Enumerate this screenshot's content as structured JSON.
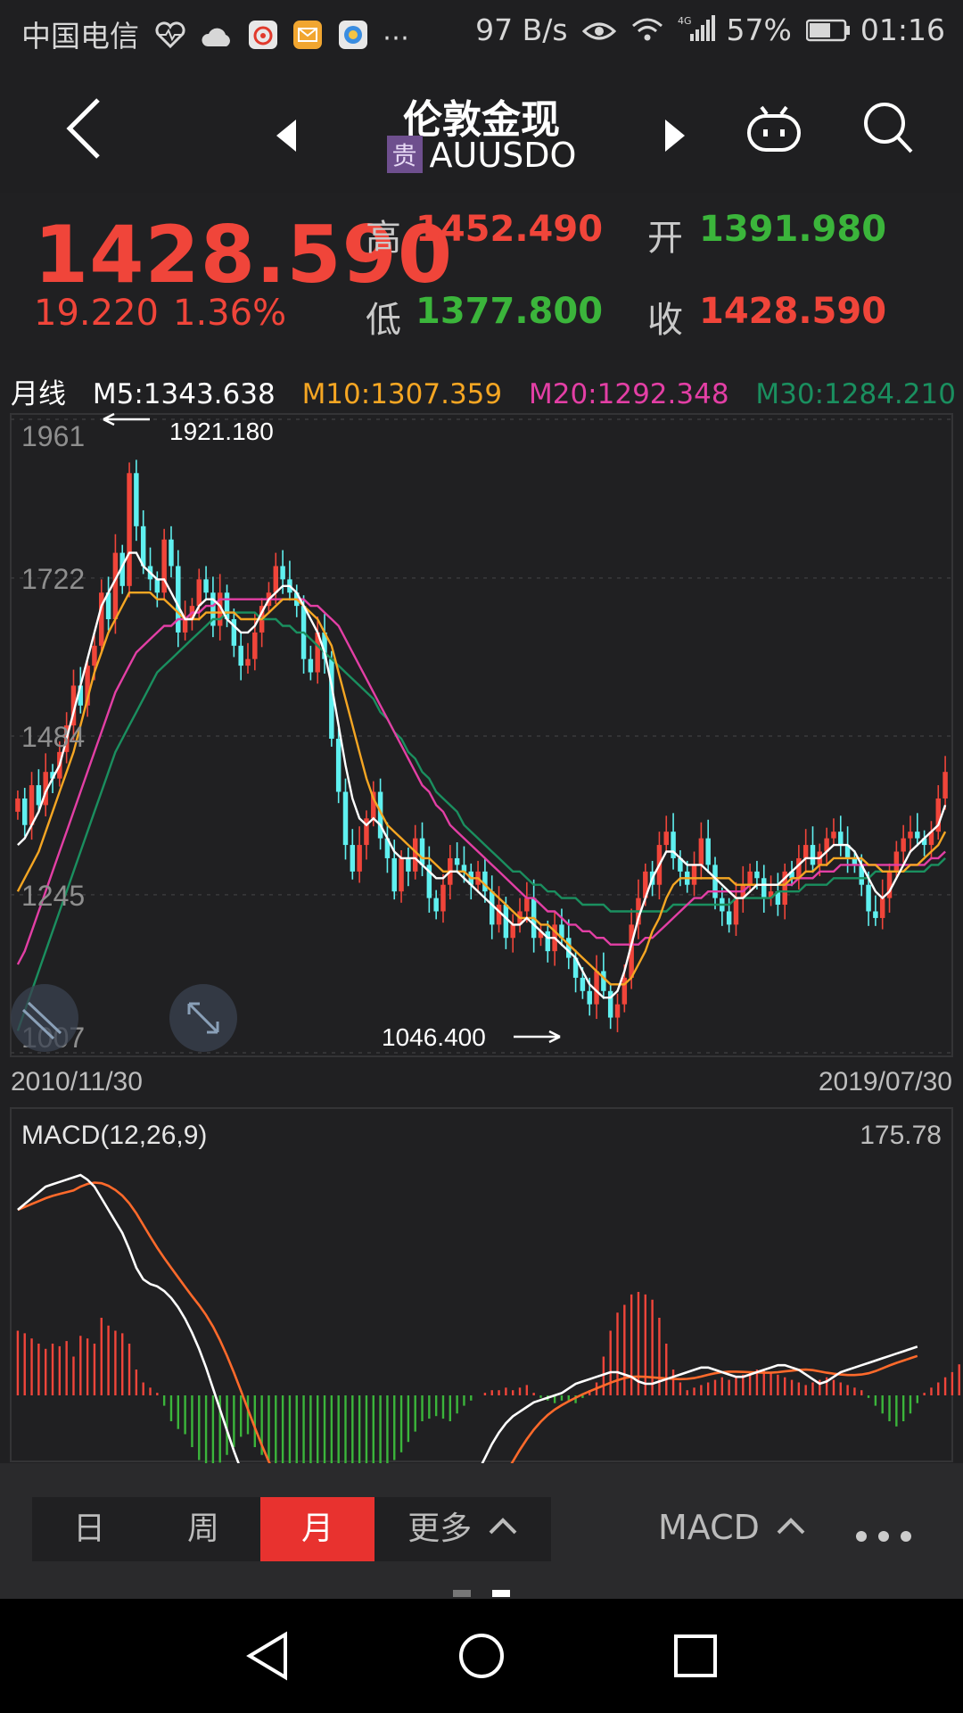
{
  "status_bar": {
    "carrier": "中国电信",
    "speed": "97 B/s",
    "battery": "57%",
    "time": "01:16"
  },
  "header": {
    "title": "伦敦金现",
    "category_tag": "贵",
    "symbol": "AUUSDO",
    "icons": [
      "back-arrow-icon",
      "prev-triangle-icon",
      "next-triangle-icon",
      "robot-icon",
      "search-icon"
    ]
  },
  "quote": {
    "price": "1428.590",
    "change": "19.220",
    "change_pct": "1.36%",
    "high_label": "高",
    "high": "1452.490",
    "low_label": "低",
    "low": "1377.800",
    "open_label": "开",
    "open": "1391.980",
    "close_label": "收",
    "close": "1428.590"
  },
  "ma_legend": {
    "period": "月线",
    "m5": "M5:1343.638",
    "m10": "M10:1307.359",
    "m20": "M20:1292.348",
    "m30": "M30:1284.210",
    "colors": {
      "m5": "#ffffff",
      "m10": "#f5a623",
      "m20": "#e33fa5",
      "m30": "#1a8f5f"
    }
  },
  "chart_data": [
    {
      "type": "candlestick",
      "title": "",
      "y_ticks": [
        "1961",
        "1722",
        "1484",
        "1245",
        "1007"
      ],
      "ylim": [
        1007,
        1961
      ],
      "x_start": "2010/11/30",
      "x_end": "2019/07/30",
      "max_annotation": "1921.180",
      "min_annotation": "1046.400",
      "close": [
        1390,
        1350,
        1410,
        1380,
        1430,
        1420,
        1460,
        1500,
        1560,
        1530,
        1590,
        1620,
        1700,
        1660,
        1760,
        1710,
        1880,
        1800,
        1740,
        1720,
        1700,
        1780,
        1740,
        1640,
        1660,
        1680,
        1720,
        1700,
        1650,
        1700,
        1660,
        1620,
        1590,
        1600,
        1640,
        1680,
        1700,
        1740,
        1720,
        1700,
        1680,
        1600,
        1580,
        1640,
        1600,
        1480,
        1400,
        1320,
        1280,
        1320,
        1360,
        1400,
        1330,
        1300,
        1250,
        1300,
        1280,
        1330,
        1290,
        1240,
        1220,
        1260,
        1300,
        1290,
        1280,
        1260,
        1280,
        1250,
        1200,
        1230,
        1180,
        1200,
        1220,
        1240,
        1180,
        1190,
        1160,
        1200,
        1180,
        1150,
        1120,
        1100,
        1080,
        1130,
        1100,
        1060,
        1080,
        1120,
        1200,
        1240,
        1280,
        1260,
        1320,
        1340,
        1300,
        1280,
        1260,
        1290,
        1330,
        1290,
        1240,
        1220,
        1200,
        1240,
        1260,
        1280,
        1270,
        1240,
        1250,
        1230,
        1280,
        1270,
        1300,
        1320,
        1290,
        1310,
        1330,
        1340,
        1320,
        1300,
        1290,
        1260,
        1220,
        1210,
        1240,
        1280,
        1310,
        1330,
        1340,
        1330,
        1320,
        1340,
        1390,
        1430
      ],
      "m5": [
        1320,
        1330,
        1350,
        1370,
        1400,
        1420,
        1440,
        1480,
        1520,
        1560,
        1600,
        1640,
        1680,
        1700,
        1720,
        1740,
        1760,
        1760,
        1740,
        1730,
        1720,
        1720,
        1700,
        1680,
        1660,
        1660,
        1680,
        1690,
        1690,
        1680,
        1660,
        1650,
        1640,
        1640,
        1650,
        1670,
        1690,
        1700,
        1710,
        1710,
        1700,
        1680,
        1660,
        1640,
        1610,
        1560,
        1500,
        1440,
        1390,
        1360,
        1350,
        1360,
        1350,
        1330,
        1310,
        1300,
        1300,
        1300,
        1290,
        1280,
        1270,
        1270,
        1280,
        1280,
        1270,
        1260,
        1250,
        1240,
        1230,
        1220,
        1210,
        1200,
        1200,
        1210,
        1200,
        1190,
        1180,
        1180,
        1170,
        1160,
        1150,
        1130,
        1110,
        1100,
        1090,
        1090,
        1100,
        1130,
        1170,
        1210,
        1240,
        1270,
        1290,
        1310,
        1310,
        1300,
        1290,
        1290,
        1290,
        1280,
        1270,
        1260,
        1250,
        1240,
        1240,
        1250,
        1260,
        1260,
        1260,
        1260,
        1270,
        1280,
        1290,
        1300,
        1300,
        1300,
        1310,
        1320,
        1320,
        1320,
        1310,
        1290,
        1270,
        1250,
        1240,
        1250,
        1270,
        1290,
        1310,
        1320,
        1330,
        1340,
        1350,
        1380
      ],
      "m10": [
        1250,
        1270,
        1290,
        1310,
        1340,
        1370,
        1400,
        1430,
        1460,
        1500,
        1540,
        1580,
        1610,
        1640,
        1660,
        1680,
        1700,
        1700,
        1700,
        1700,
        1690,
        1690,
        1680,
        1670,
        1660,
        1660,
        1660,
        1670,
        1670,
        1670,
        1670,
        1670,
        1660,
        1660,
        1660,
        1660,
        1670,
        1680,
        1690,
        1690,
        1690,
        1680,
        1670,
        1660,
        1640,
        1620,
        1580,
        1540,
        1500,
        1460,
        1420,
        1390,
        1370,
        1350,
        1340,
        1330,
        1320,
        1310,
        1300,
        1300,
        1290,
        1280,
        1280,
        1280,
        1280,
        1270,
        1270,
        1260,
        1250,
        1240,
        1230,
        1220,
        1210,
        1210,
        1210,
        1200,
        1200,
        1190,
        1180,
        1170,
        1160,
        1150,
        1140,
        1130,
        1120,
        1110,
        1110,
        1110,
        1120,
        1140,
        1160,
        1190,
        1210,
        1240,
        1260,
        1270,
        1270,
        1270,
        1270,
        1270,
        1270,
        1270,
        1270,
        1260,
        1260,
        1260,
        1260,
        1260,
        1260,
        1260,
        1260,
        1270,
        1270,
        1280,
        1280,
        1290,
        1290,
        1300,
        1300,
        1300,
        1300,
        1300,
        1290,
        1290,
        1280,
        1280,
        1280,
        1280,
        1290,
        1290,
        1300,
        1310,
        1320,
        1340
      ],
      "m20": [
        1140,
        1160,
        1190,
        1220,
        1250,
        1280,
        1310,
        1340,
        1370,
        1400,
        1430,
        1460,
        1490,
        1520,
        1550,
        1570,
        1590,
        1610,
        1620,
        1630,
        1640,
        1650,
        1650,
        1660,
        1660,
        1670,
        1670,
        1680,
        1680,
        1690,
        1690,
        1690,
        1690,
        1690,
        1690,
        1690,
        1690,
        1690,
        1690,
        1690,
        1690,
        1690,
        1680,
        1680,
        1670,
        1660,
        1650,
        1630,
        1610,
        1590,
        1570,
        1550,
        1530,
        1510,
        1490,
        1470,
        1450,
        1430,
        1410,
        1400,
        1380,
        1370,
        1350,
        1340,
        1330,
        1320,
        1310,
        1300,
        1290,
        1280,
        1270,
        1260,
        1250,
        1240,
        1240,
        1230,
        1220,
        1220,
        1210,
        1200,
        1200,
        1190,
        1190,
        1180,
        1180,
        1170,
        1170,
        1170,
        1170,
        1170,
        1180,
        1180,
        1190,
        1200,
        1210,
        1220,
        1230,
        1240,
        1240,
        1250,
        1250,
        1250,
        1250,
        1250,
        1250,
        1260,
        1260,
        1260,
        1260,
        1260,
        1260,
        1260,
        1270,
        1270,
        1270,
        1280,
        1280,
        1280,
        1290,
        1290,
        1290,
        1290,
        1290,
        1290,
        1290,
        1290,
        1290,
        1290,
        1290,
        1290,
        1290,
        1300,
        1300,
        1310
      ],
      "m30": [
        1040,
        1070,
        1100,
        1130,
        1160,
        1190,
        1220,
        1250,
        1280,
        1310,
        1340,
        1370,
        1400,
        1430,
        1460,
        1480,
        1500,
        1520,
        1540,
        1560,
        1580,
        1590,
        1600,
        1610,
        1620,
        1630,
        1640,
        1650,
        1660,
        1660,
        1670,
        1670,
        1670,
        1670,
        1670,
        1660,
        1660,
        1660,
        1650,
        1650,
        1640,
        1640,
        1630,
        1620,
        1610,
        1600,
        1590,
        1580,
        1570,
        1560,
        1550,
        1540,
        1520,
        1510,
        1490,
        1480,
        1460,
        1450,
        1430,
        1420,
        1400,
        1390,
        1380,
        1370,
        1350,
        1340,
        1330,
        1320,
        1310,
        1300,
        1290,
        1280,
        1280,
        1270,
        1260,
        1260,
        1250,
        1250,
        1240,
        1240,
        1240,
        1230,
        1230,
        1230,
        1230,
        1220,
        1220,
        1220,
        1220,
        1220,
        1220,
        1220,
        1220,
        1220,
        1230,
        1230,
        1230,
        1230,
        1230,
        1230,
        1230,
        1230,
        1230,
        1240,
        1240,
        1240,
        1240,
        1240,
        1240,
        1250,
        1250,
        1250,
        1250,
        1260,
        1260,
        1260,
        1260,
        1270,
        1270,
        1270,
        1270,
        1270,
        1270,
        1280,
        1280,
        1280,
        1280,
        1280,
        1280,
        1280,
        1280,
        1290,
        1290,
        1300
      ]
    },
    {
      "type": "macd",
      "title": "MACD(12,26,9)",
      "top_value": "175.78",
      "hist": [
        50,
        48,
        44,
        40,
        36,
        40,
        38,
        42,
        30,
        46,
        44,
        40,
        60,
        54,
        50,
        48,
        40,
        20,
        10,
        6,
        2,
        -8,
        -20,
        -26,
        -30,
        -40,
        -50,
        -56,
        -60,
        -52,
        -46,
        -40,
        -32,
        -30,
        -40,
        -46,
        -50,
        -60,
        -70,
        -80,
        -94,
        -110,
        -120,
        -130,
        -130,
        -124,
        -118,
        -110,
        -100,
        -90,
        -80,
        -70,
        -64,
        -56,
        -50,
        -44,
        -36,
        -28,
        -20,
        -18,
        -16,
        -18,
        -20,
        -14,
        -8,
        -4,
        0,
        2,
        4,
        4,
        6,
        4,
        6,
        8,
        2,
        -2,
        -4,
        -6,
        -4,
        -4,
        -6,
        -2,
        4,
        10,
        30,
        50,
        64,
        70,
        78,
        80,
        78,
        74,
        60,
        40,
        20,
        10,
        4,
        6,
        8,
        10,
        12,
        14,
        12,
        14,
        16,
        18,
        20,
        20,
        18,
        16,
        14,
        12,
        10,
        8,
        10,
        12,
        14,
        12,
        10,
        8,
        6,
        4,
        -2,
        -8,
        -14,
        -20,
        -24,
        -20,
        -14,
        -6,
        2,
        6,
        10,
        14,
        18,
        24
      ],
      "dif": [
        160,
        165,
        170,
        175,
        180,
        182,
        184,
        186,
        188,
        190,
        186,
        180,
        170,
        160,
        150,
        140,
        126,
        110,
        100,
        96,
        94,
        90,
        84,
        76,
        66,
        54,
        40,
        24,
        6,
        -12,
        -30,
        -48,
        -64,
        -78,
        -88,
        -96,
        -104,
        -108,
        -110,
        -112,
        -114,
        -114,
        -112,
        -112,
        -114,
        -116,
        -114,
        -114,
        -112,
        -110,
        -110,
        -112,
        -114,
        -116,
        -116,
        -114,
        -112,
        -112,
        -112,
        -114,
        -114,
        -112,
        -110,
        -104,
        -92,
        -80,
        -66,
        -54,
        -42,
        -32,
        -24,
        -18,
        -14,
        -10,
        -6,
        -4,
        -2,
        0,
        2,
        6,
        10,
        12,
        14,
        16,
        18,
        20,
        20,
        18,
        16,
        12,
        10,
        10,
        12,
        14,
        16,
        18,
        20,
        22,
        24,
        24,
        22,
        20,
        18,
        16,
        16,
        18,
        20,
        22,
        24,
        26,
        26,
        24,
        22,
        18,
        14,
        10,
        12,
        16,
        20,
        22,
        24,
        26,
        28,
        30,
        32,
        34,
        36,
        38,
        40,
        42
      ]
    }
  ],
  "toolbar": {
    "periods": [
      "日",
      "周",
      "月"
    ],
    "active_period": "月",
    "more": "更多",
    "indicator": "MACD"
  }
}
